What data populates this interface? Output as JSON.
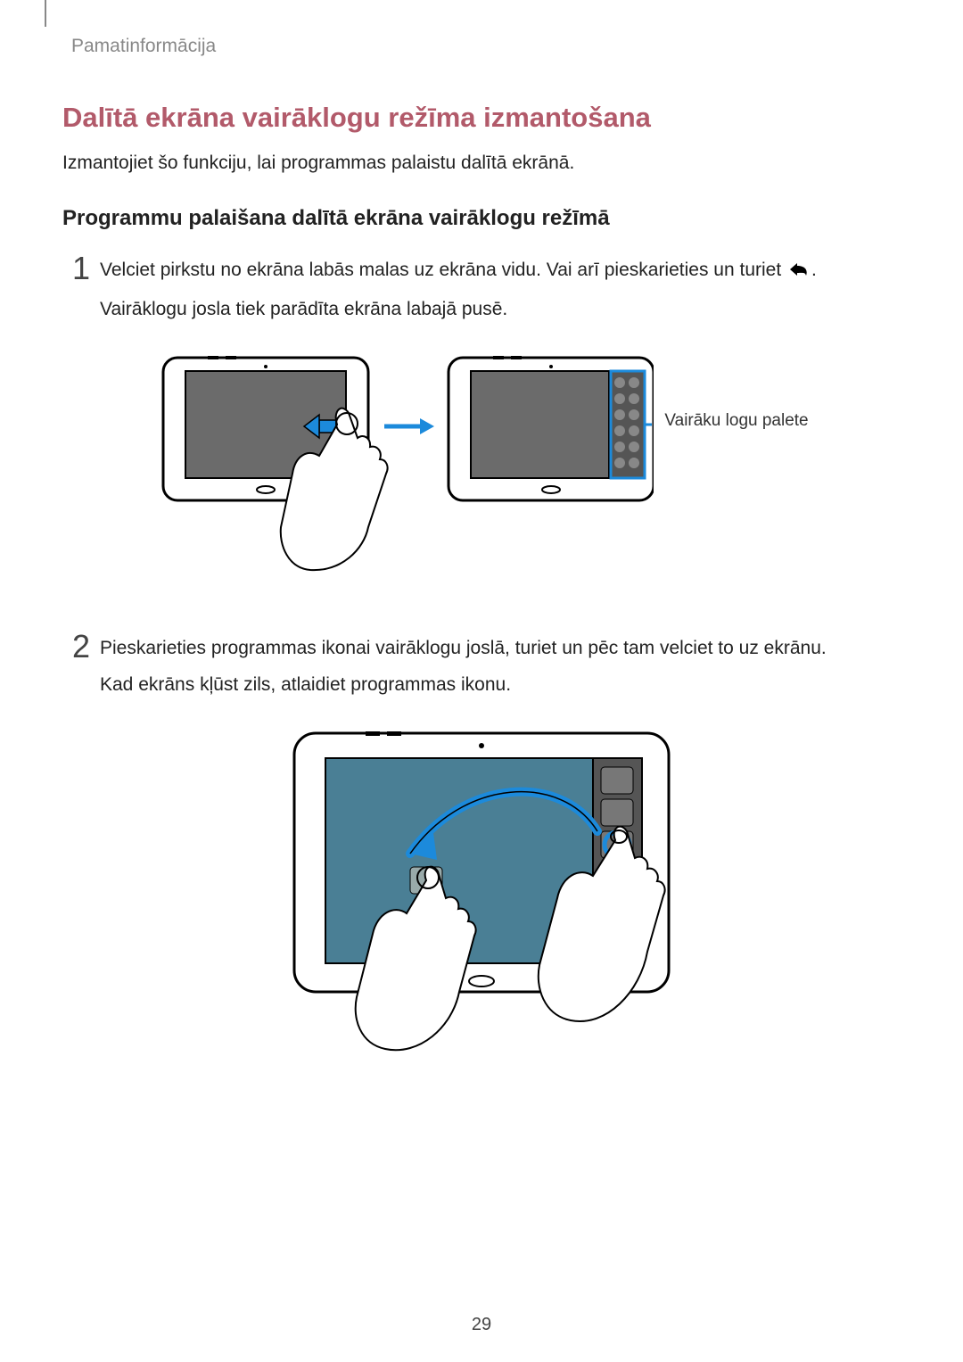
{
  "header": {
    "label": "Pamatinformācija"
  },
  "title": "Dalītā ekrāna vairāklogu režīma izmantošana",
  "intro": "Izmantojiet šo funkciju, lai programmas palaistu dalītā ekrānā.",
  "subtitle": "Programmu palaišana dalītā ekrāna vairāklogu režīmā",
  "steps": [
    {
      "num": "1",
      "line1_a": "Velciet pirkstu no ekrāna labās malas uz ekrāna vidu. Vai arī pieskarieties un turiet ",
      "line1_b": ".",
      "line2": "Vairāklogu josla tiek parādīta ekrāna labajā pusē."
    },
    {
      "num": "2",
      "line1": "Pieskarieties programmas ikonai vairāklogu joslā, turiet un pēc tam velciet to uz ekrānu.",
      "line2": "Kad ekrāns kļūst zils, atlaidiet programmas ikonu."
    }
  ],
  "callout": "Vairāku logu palete",
  "page_number": "29"
}
